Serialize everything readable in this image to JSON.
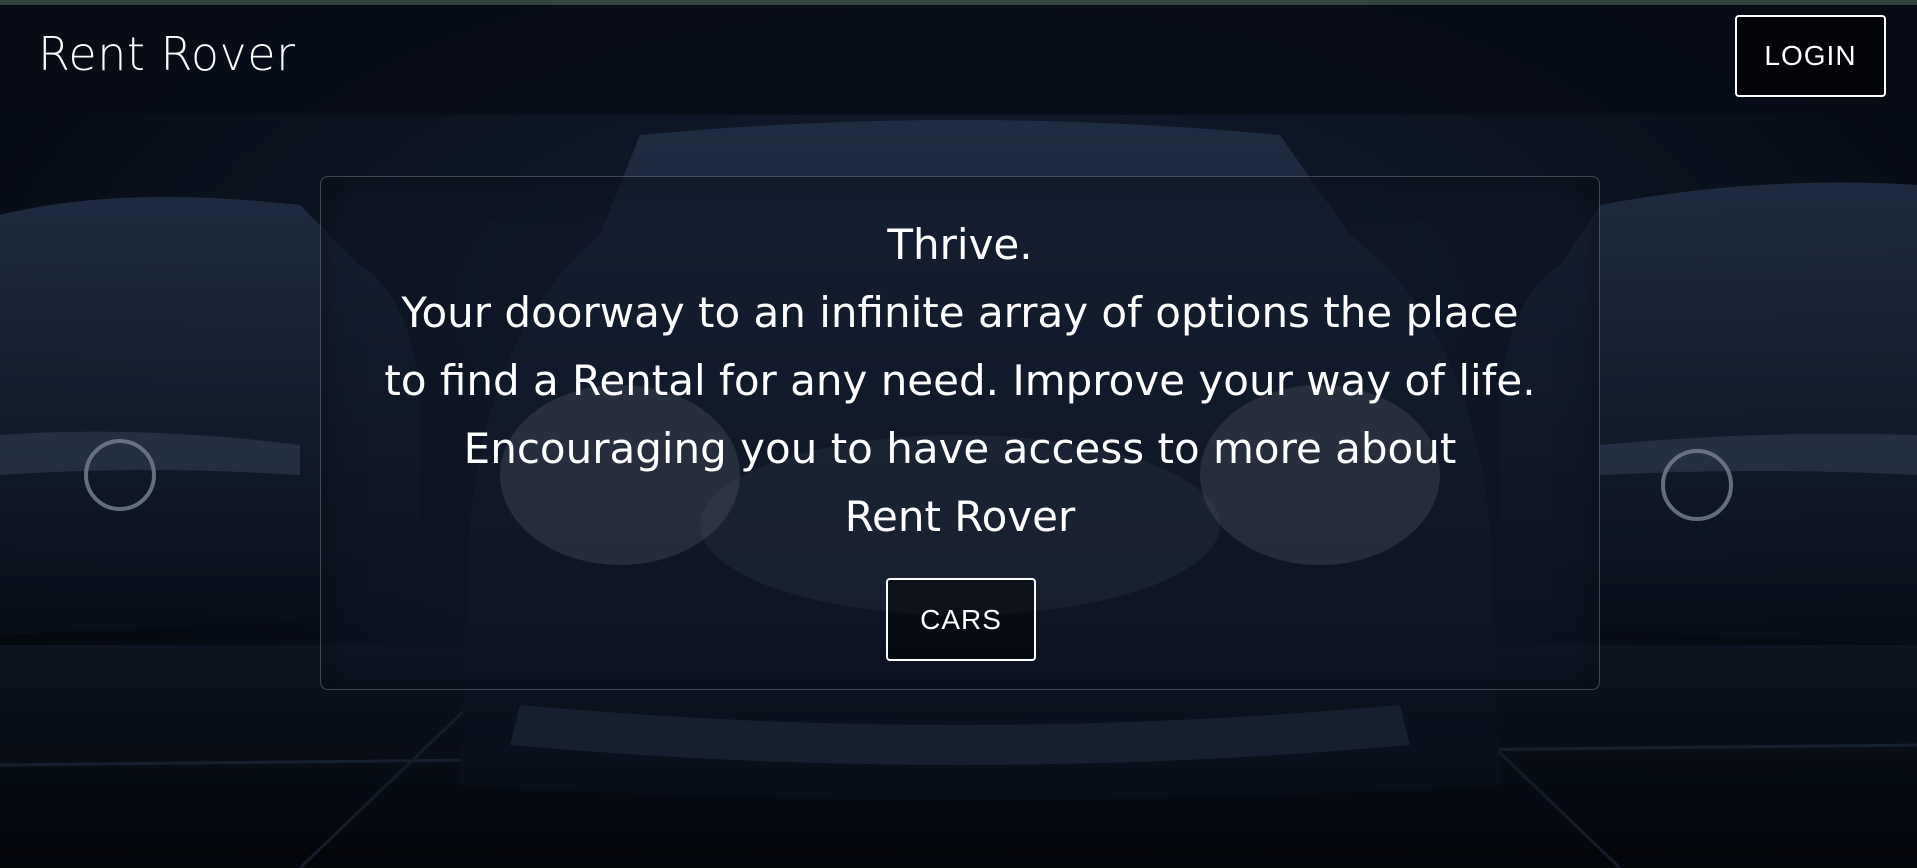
{
  "app": {
    "brand": "Rent Rover"
  },
  "nav": {
    "login_label": "LOGIN"
  },
  "hero": {
    "lines": [
      "Thrive.",
      "Your doorway to an infinite array of options the place",
      "to find a Rental for any need. Improve your way of life.",
      "Encouraging you to have access to more about",
      "Rent Rover"
    ],
    "cta_label": "CARS"
  },
  "theme": {
    "background": "#0b1424",
    "card_tint": "#0e1626",
    "text": "#ffffff",
    "top_strip": "#33453e"
  },
  "icons": {
    "background": "car-lineup-photo"
  }
}
